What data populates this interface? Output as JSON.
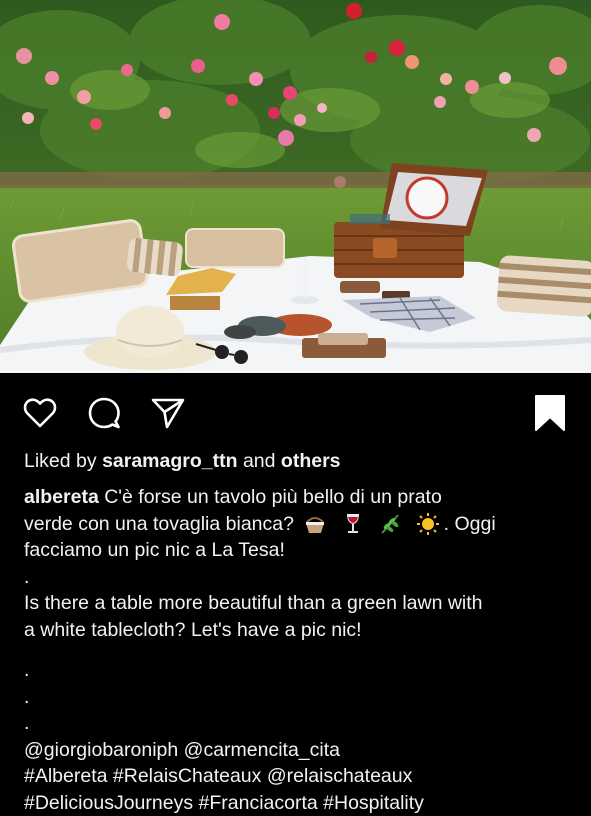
{
  "post": {
    "image_alt": "Picnic on white tablecloth in a rose garden",
    "actions": {
      "like_icon": "heart-outline-icon",
      "comment_icon": "comment-bubble-icon",
      "share_icon": "paper-plane-icon",
      "save_icon": "bookmark-filled-icon"
    },
    "likes": {
      "prefix": "Liked by",
      "user": "saramagro_ttn",
      "conjunction": "and",
      "others": "others"
    },
    "caption": {
      "username": "albereta",
      "line1_text": "C'è forse un tavolo più bello di un prato",
      "line2_text": "verde con una tovaglia bianca?",
      "line2_end": ". Oggi",
      "line3": "facciamo un pic nic a La Tesa!",
      "dot": ".",
      "en_line1": "Is there a table more beautiful than a green lawn with",
      "en_line2": "a white tablecloth? Let's have a pic nic!",
      "mentions_line": "@giorgiobaroniph @carmencita_cita",
      "hashtags_line1": "#Albereta #RelaisChateaux @relaischateaux",
      "hashtags_line2": "#DeliciousJourneys #Franciacorta #Hospitality"
    },
    "emoji": [
      "basket-emoji",
      "wine-glass-emoji",
      "herb-emoji",
      "sun-emoji"
    ]
  }
}
